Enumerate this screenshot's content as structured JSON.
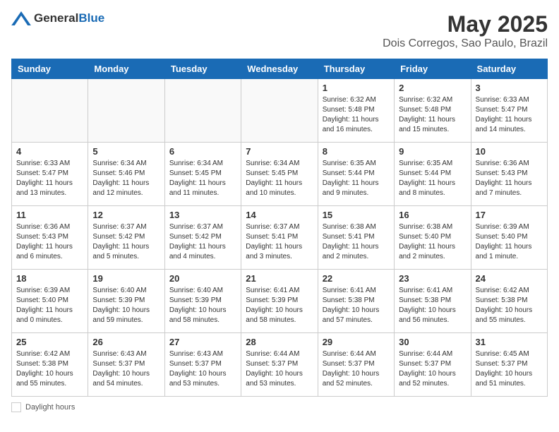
{
  "header": {
    "logo_general": "General",
    "logo_blue": "Blue",
    "title": "May 2025",
    "subtitle": "Dois Corregos, Sao Paulo, Brazil"
  },
  "days_of_week": [
    "Sunday",
    "Monday",
    "Tuesday",
    "Wednesday",
    "Thursday",
    "Friday",
    "Saturday"
  ],
  "footer_label": "Daylight hours",
  "weeks": [
    [
      {
        "day": "",
        "info": ""
      },
      {
        "day": "",
        "info": ""
      },
      {
        "day": "",
        "info": ""
      },
      {
        "day": "",
        "info": ""
      },
      {
        "day": "1",
        "info": "Sunrise: 6:32 AM\nSunset: 5:48 PM\nDaylight: 11 hours and 16 minutes."
      },
      {
        "day": "2",
        "info": "Sunrise: 6:32 AM\nSunset: 5:48 PM\nDaylight: 11 hours and 15 minutes."
      },
      {
        "day": "3",
        "info": "Sunrise: 6:33 AM\nSunset: 5:47 PM\nDaylight: 11 hours and 14 minutes."
      }
    ],
    [
      {
        "day": "4",
        "info": "Sunrise: 6:33 AM\nSunset: 5:47 PM\nDaylight: 11 hours and 13 minutes."
      },
      {
        "day": "5",
        "info": "Sunrise: 6:34 AM\nSunset: 5:46 PM\nDaylight: 11 hours and 12 minutes."
      },
      {
        "day": "6",
        "info": "Sunrise: 6:34 AM\nSunset: 5:45 PM\nDaylight: 11 hours and 11 minutes."
      },
      {
        "day": "7",
        "info": "Sunrise: 6:34 AM\nSunset: 5:45 PM\nDaylight: 11 hours and 10 minutes."
      },
      {
        "day": "8",
        "info": "Sunrise: 6:35 AM\nSunset: 5:44 PM\nDaylight: 11 hours and 9 minutes."
      },
      {
        "day": "9",
        "info": "Sunrise: 6:35 AM\nSunset: 5:44 PM\nDaylight: 11 hours and 8 minutes."
      },
      {
        "day": "10",
        "info": "Sunrise: 6:36 AM\nSunset: 5:43 PM\nDaylight: 11 hours and 7 minutes."
      }
    ],
    [
      {
        "day": "11",
        "info": "Sunrise: 6:36 AM\nSunset: 5:43 PM\nDaylight: 11 hours and 6 minutes."
      },
      {
        "day": "12",
        "info": "Sunrise: 6:37 AM\nSunset: 5:42 PM\nDaylight: 11 hours and 5 minutes."
      },
      {
        "day": "13",
        "info": "Sunrise: 6:37 AM\nSunset: 5:42 PM\nDaylight: 11 hours and 4 minutes."
      },
      {
        "day": "14",
        "info": "Sunrise: 6:37 AM\nSunset: 5:41 PM\nDaylight: 11 hours and 3 minutes."
      },
      {
        "day": "15",
        "info": "Sunrise: 6:38 AM\nSunset: 5:41 PM\nDaylight: 11 hours and 2 minutes."
      },
      {
        "day": "16",
        "info": "Sunrise: 6:38 AM\nSunset: 5:40 PM\nDaylight: 11 hours and 2 minutes."
      },
      {
        "day": "17",
        "info": "Sunrise: 6:39 AM\nSunset: 5:40 PM\nDaylight: 11 hours and 1 minute."
      }
    ],
    [
      {
        "day": "18",
        "info": "Sunrise: 6:39 AM\nSunset: 5:40 PM\nDaylight: 11 hours and 0 minutes."
      },
      {
        "day": "19",
        "info": "Sunrise: 6:40 AM\nSunset: 5:39 PM\nDaylight: 10 hours and 59 minutes."
      },
      {
        "day": "20",
        "info": "Sunrise: 6:40 AM\nSunset: 5:39 PM\nDaylight: 10 hours and 58 minutes."
      },
      {
        "day": "21",
        "info": "Sunrise: 6:41 AM\nSunset: 5:39 PM\nDaylight: 10 hours and 58 minutes."
      },
      {
        "day": "22",
        "info": "Sunrise: 6:41 AM\nSunset: 5:38 PM\nDaylight: 10 hours and 57 minutes."
      },
      {
        "day": "23",
        "info": "Sunrise: 6:41 AM\nSunset: 5:38 PM\nDaylight: 10 hours and 56 minutes."
      },
      {
        "day": "24",
        "info": "Sunrise: 6:42 AM\nSunset: 5:38 PM\nDaylight: 10 hours and 55 minutes."
      }
    ],
    [
      {
        "day": "25",
        "info": "Sunrise: 6:42 AM\nSunset: 5:38 PM\nDaylight: 10 hours and 55 minutes."
      },
      {
        "day": "26",
        "info": "Sunrise: 6:43 AM\nSunset: 5:37 PM\nDaylight: 10 hours and 54 minutes."
      },
      {
        "day": "27",
        "info": "Sunrise: 6:43 AM\nSunset: 5:37 PM\nDaylight: 10 hours and 53 minutes."
      },
      {
        "day": "28",
        "info": "Sunrise: 6:44 AM\nSunset: 5:37 PM\nDaylight: 10 hours and 53 minutes."
      },
      {
        "day": "29",
        "info": "Sunrise: 6:44 AM\nSunset: 5:37 PM\nDaylight: 10 hours and 52 minutes."
      },
      {
        "day": "30",
        "info": "Sunrise: 6:44 AM\nSunset: 5:37 PM\nDaylight: 10 hours and 52 minutes."
      },
      {
        "day": "31",
        "info": "Sunrise: 6:45 AM\nSunset: 5:37 PM\nDaylight: 10 hours and 51 minutes."
      }
    ]
  ]
}
